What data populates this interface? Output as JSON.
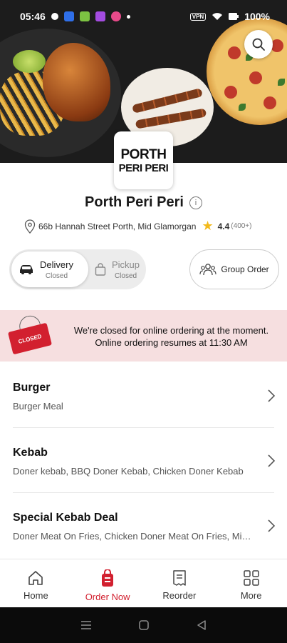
{
  "status_bar": {
    "time": "05:46",
    "battery": "100%"
  },
  "restaurant": {
    "logo_line1": "PORTH",
    "logo_line2": "PERI PERI",
    "name": "Porth Peri Peri",
    "address": "66b Hannah Street Porth, Mid Glamorgan",
    "rating": "4.4",
    "rating_count": "(400+)"
  },
  "order_type": {
    "delivery": {
      "label": "Delivery",
      "status": "Closed"
    },
    "pickup": {
      "label": "Pickup",
      "status": "Closed"
    },
    "group_order_label": "Group Order"
  },
  "banner": {
    "sign_text": "CLOSED",
    "line1": "We're closed for online ordering at the moment.",
    "line2": "Online ordering resumes at 11:30 AM"
  },
  "menu": [
    {
      "title": "Burger",
      "desc": "Burger Meal"
    },
    {
      "title": "Kebab",
      "desc": "Doner kebab, BBQ Doner Kebab, Chicken Doner Kebab"
    },
    {
      "title": "Special Kebab Deal",
      "desc": "Doner Meat On Fries, Chicken Doner Meat On Fries, Mix Meat"
    }
  ],
  "bottom_nav": [
    {
      "label": "Home",
      "icon": "home-icon"
    },
    {
      "label": "Order Now",
      "icon": "order-bag-icon"
    },
    {
      "label": "Reorder",
      "icon": "receipt-icon"
    },
    {
      "label": "More",
      "icon": "grid-icon"
    }
  ],
  "colors": {
    "accent": "#d2202f",
    "banner_bg": "#f6dfe0",
    "star": "#f2b91b"
  }
}
